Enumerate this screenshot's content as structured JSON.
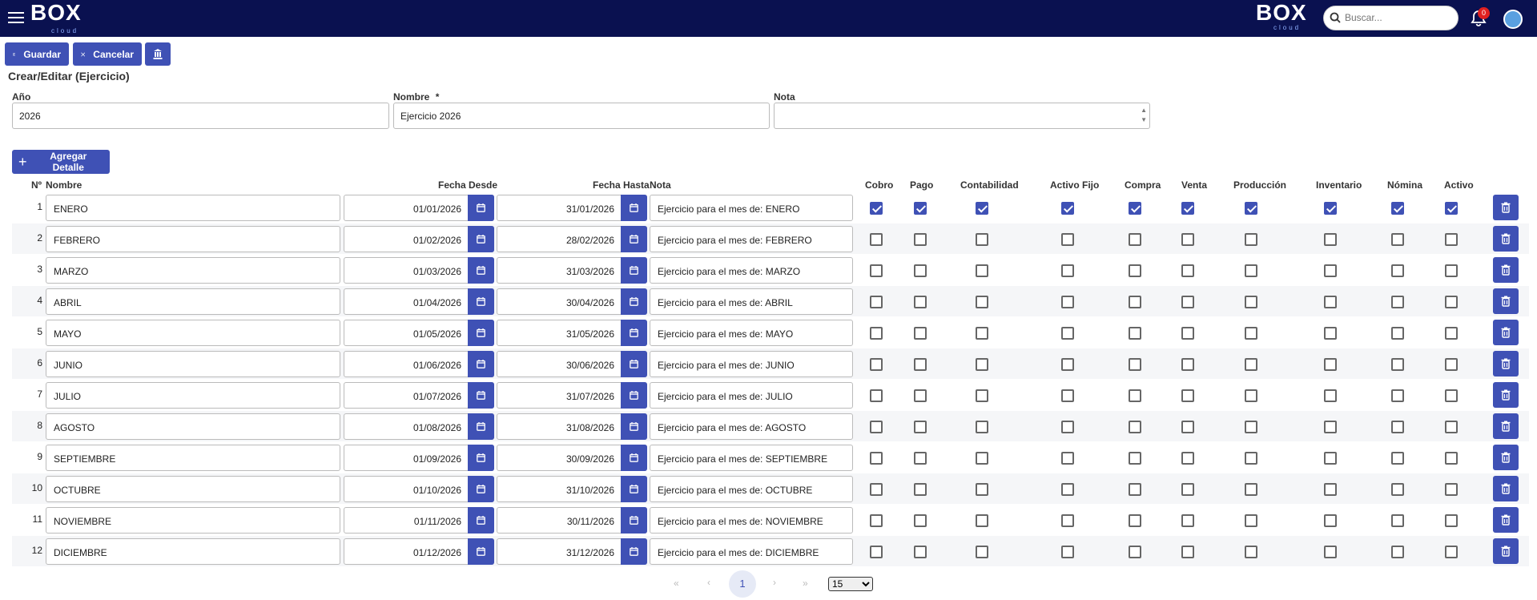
{
  "header": {
    "logo_text_left": "BOX",
    "logo_sub": "cloud",
    "logo_text_right": "BOX",
    "search_placeholder": "Buscar...",
    "notification_count": "0"
  },
  "toolbar": {
    "save_label": "Guardar",
    "cancel_label": "Cancelar"
  },
  "page_title": "Crear/Editar (Ejercicio)",
  "form": {
    "year_label": "Año",
    "year_value": "2026",
    "name_label": "Nombre",
    "name_required": "*",
    "name_value": "Ejercicio 2026",
    "note_label": "Nota",
    "note_value": ""
  },
  "add_detail_label": "Agregar Detalle",
  "table": {
    "headers": {
      "num": "Nº",
      "name": "Nombre",
      "from": "Fecha Desde",
      "to": "Fecha Hasta",
      "note": "Nota",
      "cobro": "Cobro",
      "pago": "Pago",
      "contabilidad": "Contabilidad",
      "activo_fijo": "Activo Fijo",
      "compra": "Compra",
      "venta": "Venta",
      "produccion": "Producción",
      "inventario": "Inventario",
      "nomina": "Nómina",
      "activo": "Activo"
    },
    "rows": [
      {
        "num": "1",
        "name": "ENERO",
        "from": "01/01/2026",
        "to": "31/01/2026",
        "note": "Ejercicio para el mes de: ENERO",
        "checks": [
          true,
          true,
          true,
          true,
          true,
          true,
          true,
          true,
          true,
          true
        ]
      },
      {
        "num": "2",
        "name": "FEBRERO",
        "from": "01/02/2026",
        "to": "28/02/2026",
        "note": "Ejercicio para el mes de: FEBRERO",
        "checks": [
          false,
          false,
          false,
          false,
          false,
          false,
          false,
          false,
          false,
          false
        ]
      },
      {
        "num": "3",
        "name": "MARZO",
        "from": "01/03/2026",
        "to": "31/03/2026",
        "note": "Ejercicio para el mes de: MARZO",
        "checks": [
          false,
          false,
          false,
          false,
          false,
          false,
          false,
          false,
          false,
          false
        ]
      },
      {
        "num": "4",
        "name": "ABRIL",
        "from": "01/04/2026",
        "to": "30/04/2026",
        "note": "Ejercicio para el mes de: ABRIL",
        "checks": [
          false,
          false,
          false,
          false,
          false,
          false,
          false,
          false,
          false,
          false
        ]
      },
      {
        "num": "5",
        "name": "MAYO",
        "from": "01/05/2026",
        "to": "31/05/2026",
        "note": "Ejercicio para el mes de: MAYO",
        "checks": [
          false,
          false,
          false,
          false,
          false,
          false,
          false,
          false,
          false,
          false
        ]
      },
      {
        "num": "6",
        "name": "JUNIO",
        "from": "01/06/2026",
        "to": "30/06/2026",
        "note": "Ejercicio para el mes de: JUNIO",
        "checks": [
          false,
          false,
          false,
          false,
          false,
          false,
          false,
          false,
          false,
          false
        ]
      },
      {
        "num": "7",
        "name": "JULIO",
        "from": "01/07/2026",
        "to": "31/07/2026",
        "note": "Ejercicio para el mes de: JULIO",
        "checks": [
          false,
          false,
          false,
          false,
          false,
          false,
          false,
          false,
          false,
          false
        ]
      },
      {
        "num": "8",
        "name": "AGOSTO",
        "from": "01/08/2026",
        "to": "31/08/2026",
        "note": "Ejercicio para el mes de: AGOSTO",
        "checks": [
          false,
          false,
          false,
          false,
          false,
          false,
          false,
          false,
          false,
          false
        ]
      },
      {
        "num": "9",
        "name": "SEPTIEMBRE",
        "from": "01/09/2026",
        "to": "30/09/2026",
        "note": "Ejercicio para el mes de: SEPTIEMBRE",
        "checks": [
          false,
          false,
          false,
          false,
          false,
          false,
          false,
          false,
          false,
          false
        ]
      },
      {
        "num": "10",
        "name": "OCTUBRE",
        "from": "01/10/2026",
        "to": "31/10/2026",
        "note": "Ejercicio para el mes de: OCTUBRE",
        "checks": [
          false,
          false,
          false,
          false,
          false,
          false,
          false,
          false,
          false,
          false
        ]
      },
      {
        "num": "11",
        "name": "NOVIEMBRE",
        "from": "01/11/2026",
        "to": "30/11/2026",
        "note": "Ejercicio para el mes de: NOVIEMBRE",
        "checks": [
          false,
          false,
          false,
          false,
          false,
          false,
          false,
          false,
          false,
          false
        ]
      },
      {
        "num": "12",
        "name": "DICIEMBRE",
        "from": "01/12/2026",
        "to": "31/12/2026",
        "note": "Ejercicio para el mes de: DICIEMBRE",
        "checks": [
          false,
          false,
          false,
          false,
          false,
          false,
          false,
          false,
          false,
          false
        ]
      }
    ]
  },
  "pagination": {
    "first": "«",
    "prev": "‹",
    "current": "1",
    "next": "›",
    "last": "»",
    "page_size": "15"
  },
  "colors": {
    "topbar": "#0a1150",
    "accent": "#3f51b5"
  }
}
